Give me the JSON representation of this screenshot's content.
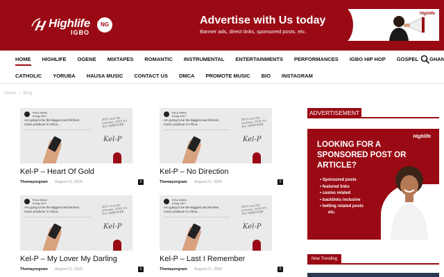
{
  "header": {
    "logo": {
      "text": "Highlife",
      "sub": "IGBO",
      "badge": "NG"
    },
    "ad": {
      "title": "Advertise with Us today.",
      "subtitle": "Banner ads, direct links, sponsored posts, etc."
    }
  },
  "nav": {
    "row1": [
      "HOME",
      "HIGHLIFE",
      "OGENE",
      "MIXTAPES",
      "ROMANTIC",
      "INSTRUMENTAL",
      "ENTERTAINMENTS",
      "PERFORMANCES",
      "IGBO HIP HOP",
      "GOSPEL",
      "GHANA"
    ],
    "row2": [
      "CATHOLIC",
      "YORUBA",
      "HAUSA MUSIC",
      "CONTACT US",
      "DMCA",
      "PROMOTE MUSIC",
      "BIO",
      "INSTAGRAM"
    ],
    "active": "HOME"
  },
  "breadcrumb": {
    "home": "Home",
    "sep": "›",
    "current": "Blog"
  },
  "thumbnail": {
    "name": "Kel-p Amba",
    "handle": "8 Aug 2017",
    "text": "Am going to be the Biggest and Richest music producer in Africa...",
    "script": "2015 was the promise. 2016 it's the TAKEOVER",
    "signature": "Kel-P"
  },
  "posts": [
    {
      "title": "Kel-P – Heart Of Gold",
      "author": "Themayorgram",
      "date": "August 21, 2026",
      "comments": "0"
    },
    {
      "title": "Kel-P – No Direction",
      "author": "Themayorgram",
      "date": "August 21, 2026",
      "comments": "0"
    },
    {
      "title": "Kel-P – My Lover My Darling",
      "author": "Themayorgram",
      "date": "August 21, 2026",
      "comments": "0"
    },
    {
      "title": "Kel-P – Last I Remember",
      "author": "Themayorgram",
      "date": "August 21, 2026",
      "comments": "0"
    }
  ],
  "sidebar": {
    "ad_heading": "ADVERTISEMENT",
    "ad": {
      "brand": "Highlife",
      "title": "LOOKING FOR A SPONSORED POST OR ARTICLE?",
      "items": [
        "Sponsored posts",
        "featured links",
        "casino related",
        "backlinks inclusive",
        "betting related posts",
        "etc."
      ]
    },
    "trending_heading": "Now Trending"
  },
  "colors": {
    "brand": "#9a0a14",
    "text": "#111111",
    "muted": "#999999"
  },
  "icons": {
    "search": "search-icon",
    "comments": "comment-count-badge"
  }
}
